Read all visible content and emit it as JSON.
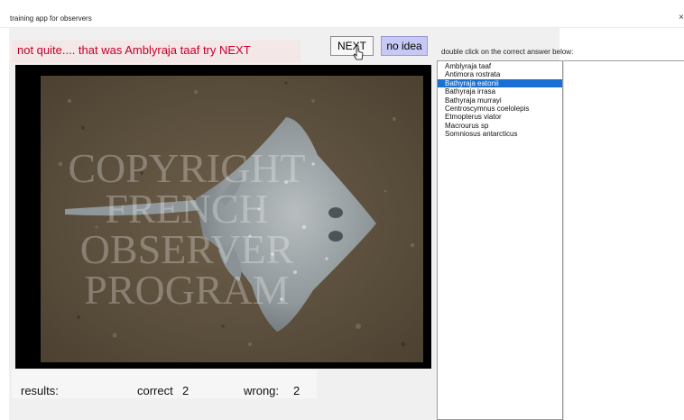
{
  "window": {
    "title": "training app for observers",
    "close_glyph": "×"
  },
  "feedback": {
    "text": "not quite.... that was Amblyraja taaf try NEXT",
    "color": "#c4002a"
  },
  "buttons": {
    "next_label": "NEXT",
    "no_idea_label": "no idea",
    "no_idea_color": "#c8c8f4"
  },
  "instructions": "double click on the correct answer below:",
  "photo": {
    "watermark_lines": [
      "COPYRIGHT",
      "FRENCH",
      "OBSERVER",
      "PROGRAM"
    ]
  },
  "species_list": {
    "items": [
      "Amblyraja taaf",
      "Antimora rostrata",
      "Bathyraja eatonii",
      "Bathyraja irrasa",
      "Bathyraja murrayi",
      "Centroscymnus coelolepis",
      "Etmopterus viator",
      "Macrourus sp",
      "Somniosus antarcticus"
    ],
    "selected_index": 2,
    "selection_color": "#1a6fd2"
  },
  "results": {
    "label": "results:",
    "correct_label": "correct",
    "correct_value": "2",
    "wrong_label": "wrong:",
    "wrong_value": "2"
  },
  "icons": {
    "cursor": "pointer-cursor-icon"
  }
}
